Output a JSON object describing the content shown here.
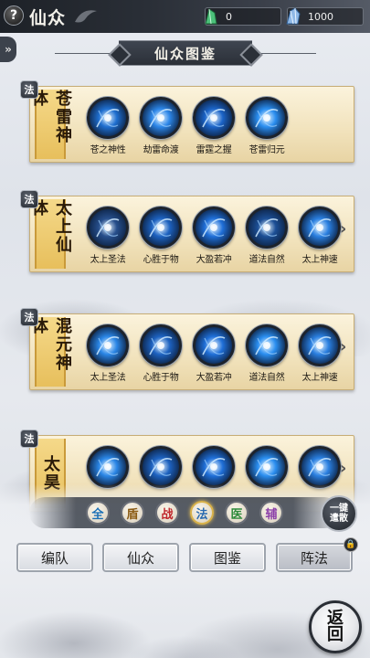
{
  "topbar": {
    "help_label": "?",
    "title": "仙众",
    "currency1": {
      "icon": "green-crystal-icon",
      "value": "0"
    },
    "currency2": {
      "icon": "blue-crystal-icon",
      "value": "1000"
    }
  },
  "side_toggle": "»",
  "header": {
    "title": "仙众图鉴"
  },
  "cards": [
    {
      "tag": "法",
      "name": "苍雷神体",
      "has_more": false,
      "skills": [
        {
          "label": "苍之神性",
          "color": "#1f6fd0",
          "icon": "spirit-figure-icon"
        },
        {
          "label": "劫雷命渡",
          "color": "#2c86e8",
          "icon": "lightning-icon"
        },
        {
          "label": "雷霆之握",
          "color": "#1b64c8",
          "icon": "thunder-grip-icon"
        },
        {
          "label": "苍雷归元",
          "color": "#2a8ef0",
          "icon": "vortex-icon"
        }
      ]
    },
    {
      "tag": "法",
      "name": "太上仙体",
      "has_more": true,
      "skills": [
        {
          "label": "太上圣法",
          "color": "#274f8c",
          "icon": "meditation-icon"
        },
        {
          "label": "心胜于物",
          "color": "#1d62c0",
          "icon": "star-burst-icon"
        },
        {
          "label": "大盈若冲",
          "color": "#1f6fd8",
          "icon": "wave-icon"
        },
        {
          "label": "道法自然",
          "color": "#1c4f96",
          "icon": "yin-yang-icon"
        },
        {
          "label": "太上神速",
          "color": "#2a7fe0",
          "icon": "dash-icon"
        }
      ]
    },
    {
      "tag": "法",
      "name": "混元神体",
      "has_more": true,
      "skills": [
        {
          "label": "太上圣法",
          "color": "#2a86e6",
          "icon": "star-burst-icon"
        },
        {
          "label": "心胜于物",
          "color": "#1d62c0",
          "icon": "lightning-icon"
        },
        {
          "label": "大盈若冲",
          "color": "#1f6fd8",
          "icon": "orb-icon"
        },
        {
          "label": "道法自然",
          "color": "#2a8ef0",
          "icon": "vortex-icon"
        },
        {
          "label": "太上神速",
          "color": "#2a7fe0",
          "icon": "dash-icon"
        }
      ]
    },
    {
      "tag": "法",
      "name": "太昊",
      "has_more": true,
      "skills": [
        {
          "label": "",
          "color": "#2a86e6",
          "icon": "star-burst-icon"
        },
        {
          "label": "",
          "color": "#1d62c0",
          "icon": "lightning-icon"
        },
        {
          "label": "",
          "color": "#1f6fd8",
          "icon": "orb-icon"
        },
        {
          "label": "",
          "color": "#2a8ef0",
          "icon": "vortex-icon"
        },
        {
          "label": "",
          "color": "#2a7fe0",
          "icon": "dash-icon"
        }
      ]
    }
  ],
  "filters": [
    {
      "label": "全",
      "color": "#1a6fb5",
      "active": false
    },
    {
      "label": "盾",
      "color": "#8a5a12",
      "active": false
    },
    {
      "label": "战",
      "color": "#c0262b",
      "active": false
    },
    {
      "label": "法",
      "color": "#2a6ab0",
      "active": true
    },
    {
      "label": "医",
      "color": "#2d8a3a",
      "active": false
    },
    {
      "label": "辅",
      "color": "#8b3fa8",
      "active": false
    }
  ],
  "one_key": {
    "label": "一键\n遣散"
  },
  "nav": [
    {
      "label": "编队"
    },
    {
      "label": "仙众"
    },
    {
      "label": "图鉴"
    },
    {
      "label": "阵法"
    }
  ],
  "back": {
    "label": "返\n回"
  }
}
